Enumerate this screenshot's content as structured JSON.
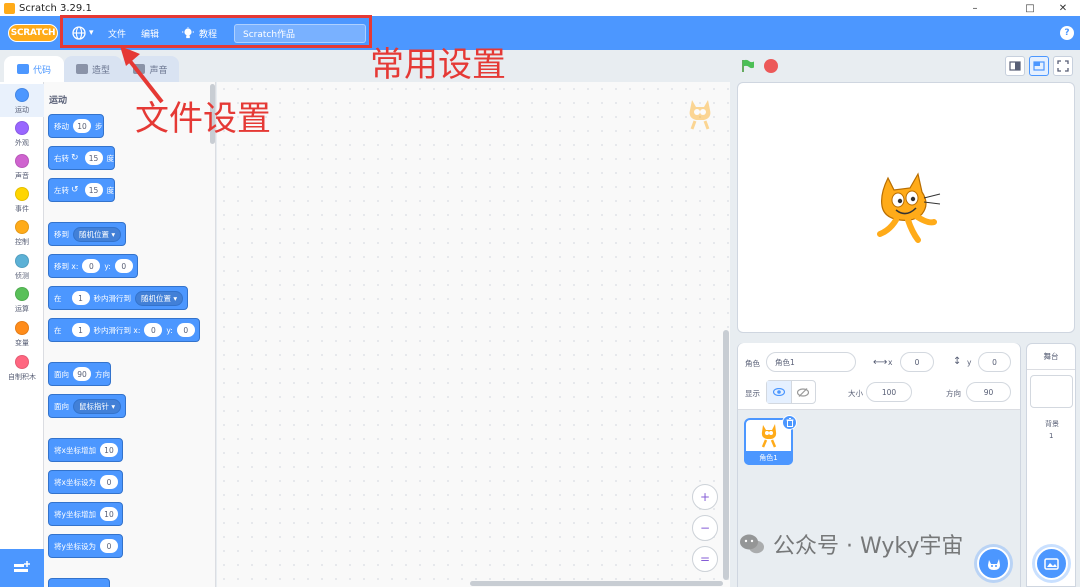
{
  "window": {
    "title": "Scratch 3.29.1",
    "minimize": "–",
    "maximize": "□",
    "close": "✕"
  },
  "menubar": {
    "logo": "SCRATCH",
    "language_icon": "globe-icon",
    "language_caret": "▾",
    "file": "文件",
    "edit": "编辑",
    "tutorials": "教程",
    "project_title": "Scratch作品",
    "help": "?"
  },
  "tabs": {
    "code": "代码",
    "costumes": "造型",
    "sounds": "声音"
  },
  "categories": [
    {
      "label": "运动",
      "color": "#4c97ff"
    },
    {
      "label": "外观",
      "color": "#9966ff"
    },
    {
      "label": "声音",
      "color": "#cf63cf"
    },
    {
      "label": "事件",
      "color": "#ffd500"
    },
    {
      "label": "控制",
      "color": "#ffab19"
    },
    {
      "label": "侦测",
      "color": "#5cb1d6"
    },
    {
      "label": "运算",
      "color": "#59c059"
    },
    {
      "label": "变量",
      "color": "#ff8c1a"
    },
    {
      "label": "自制积木",
      "color": "#ff6680"
    }
  ],
  "palette": {
    "heading": "运动",
    "move": {
      "pre": "移动",
      "value": "10",
      "post": "步"
    },
    "turn_right": {
      "pre": "右转",
      "glyph": "↻",
      "value": "15",
      "post": "度"
    },
    "turn_left": {
      "pre": "左转",
      "glyph": "↺",
      "value": "15",
      "post": "度"
    },
    "goto": {
      "pre": "移到",
      "dropdown": "随机位置 ▾"
    },
    "goto_xy": {
      "pre": "移到 x:",
      "x": "0",
      "mid": "y:",
      "y": "0"
    },
    "glide": {
      "pre": "在",
      "value": "1",
      "mid": "秒内滑行到",
      "dropdown": "随机位置 ▾"
    },
    "glide_xy": {
      "pre": "在",
      "value": "1",
      "mid": "秒内滑行到 x:",
      "x": "0",
      "mid2": "y:",
      "y": "0"
    },
    "point": {
      "pre": "面向",
      "value": "90",
      "post": "方向"
    },
    "point_towards": {
      "pre": "面向",
      "dropdown": "鼠标指针 ▾"
    },
    "change_x": {
      "pre": "将x坐标增加",
      "value": "10"
    },
    "set_x": {
      "pre": "将x坐标设为",
      "value": "0"
    },
    "change_y": {
      "pre": "将y坐标增加",
      "value": "10"
    },
    "set_y": {
      "pre": "将y坐标设为",
      "value": "0"
    }
  },
  "zoom": {
    "in": "+",
    "out": "−",
    "reset": "="
  },
  "sprite_info": {
    "sprite_label": "角色",
    "sprite_name": "角色1",
    "x_label": "x",
    "x_value": "0",
    "y_label": "y",
    "y_value": "0",
    "show_label": "显示",
    "size_label": "大小",
    "size_value": "100",
    "direction_label": "方向",
    "direction_value": "90"
  },
  "sprites": [
    {
      "name": "角色1"
    }
  ],
  "stage_panel": {
    "title": "舞台",
    "backdrops_label": "背景",
    "backdrops_count": "1"
  },
  "annotations": {
    "common_settings": "常用设置",
    "file_settings": "文件设置",
    "color": "#e53935"
  },
  "watermark": "公众号 · Wyky宇宙"
}
